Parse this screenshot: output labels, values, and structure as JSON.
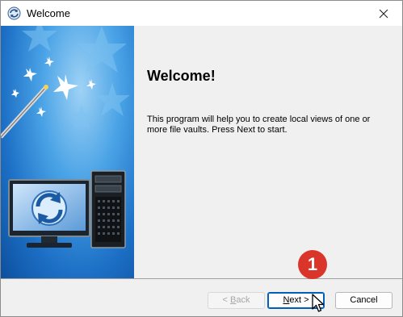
{
  "window": {
    "title": "Welcome"
  },
  "content": {
    "heading": "Welcome!",
    "description": "This program will help you to create local views of one or more file vaults. Press Next to start."
  },
  "buttons": {
    "back": {
      "prefix": "< ",
      "accel": "B",
      "rest": "ack"
    },
    "next": {
      "accel": "N",
      "rest": "ext >"
    },
    "cancel": "Cancel"
  },
  "badge": {
    "number": "1"
  },
  "colors": {
    "accent": "#005fb8",
    "badge": "#d9352a",
    "banner": "#1c6fc5"
  },
  "icons": [
    "sync-app-icon",
    "close-icon",
    "magic-wand-icon",
    "star-icon",
    "monitor-icon",
    "computer-tower-icon",
    "mouse-pointer-icon"
  ]
}
